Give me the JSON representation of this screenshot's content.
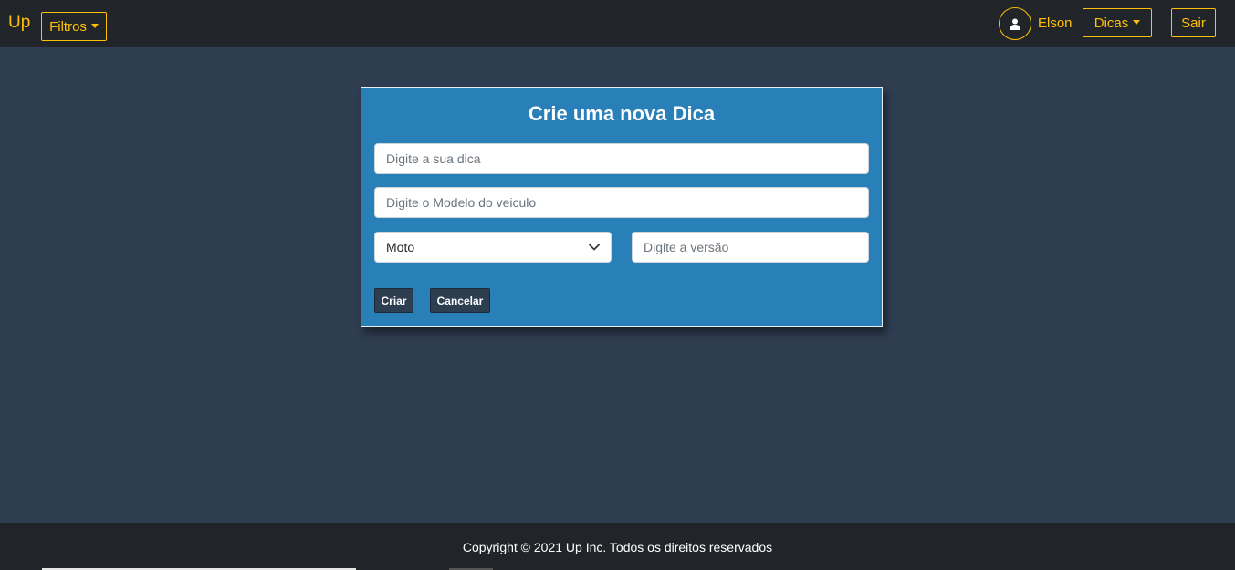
{
  "navbar": {
    "brand": "Up",
    "filters_label": "Filtros",
    "username": "Elson",
    "tips_label": "Dicas",
    "logout_label": "Sair"
  },
  "modal": {
    "title": "Crie uma nova Dica",
    "tip_input": {
      "placeholder": "Digite a sua dica",
      "value": ""
    },
    "model_input": {
      "placeholder": "Digite o Modelo do veiculo",
      "value": ""
    },
    "type_select": {
      "selected": "Moto"
    },
    "version_input": {
      "placeholder": "Digite a versão",
      "value": ""
    },
    "create_label": "Criar",
    "cancel_label": "Cancelar"
  },
  "footer": {
    "copyright": "Copyright © 2021 Up Inc. Todos os direitos reservados"
  },
  "colors": {
    "accent": "#ffc107",
    "navbar_bg": "#212529",
    "page_bg": "#2e3d50",
    "modal_bg": "#2980b9",
    "button_dark": "#2c3e50"
  },
  "icons": {
    "filters_caret": "caret-down-icon",
    "tips_caret": "caret-down-icon",
    "avatar": "user-icon",
    "select_chevron": "chevron-down-icon"
  }
}
